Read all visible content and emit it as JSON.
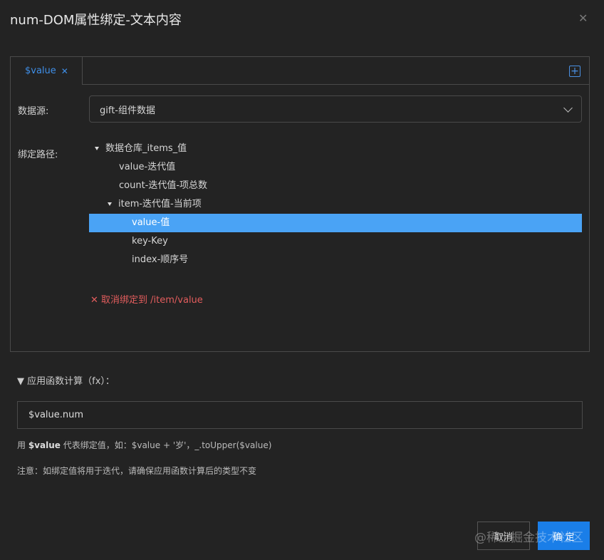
{
  "dialog": {
    "title": "num-DOM属性绑定-文本内容",
    "close_icon": "close-icon"
  },
  "tabs": [
    {
      "label": "$value",
      "close": "✕",
      "active": true
    }
  ],
  "add_tab": "+",
  "datasource": {
    "label": "数据源:",
    "value": "gift-组件数据"
  },
  "binding": {
    "label": "绑定路径:",
    "tree": [
      {
        "label": "数据仓库_items_值",
        "level": 0,
        "expanded": true
      },
      {
        "label": "value-迭代值",
        "level": 1
      },
      {
        "label": "count-迭代值-项总数",
        "level": 1
      },
      {
        "label": "item-迭代值-当前项",
        "level": 1,
        "expanded": true
      },
      {
        "label": "value-值",
        "level": 2,
        "selected": true
      },
      {
        "label": "key-Key",
        "level": 2
      },
      {
        "label": "index-顺序号",
        "level": 2
      }
    ],
    "unbind": "✕ 取消绑定到 /item/value"
  },
  "fx": {
    "header": "▼ 应用函数计算（fx）：",
    "value": "$value.num",
    "hint_prefix": "用 ",
    "hint_bold": "$value",
    "hint_suffix": " 代表绑定值，如：$value + '岁'，_.toUpper($value)",
    "note": "注意：如绑定值将用于迭代，请确保应用函数计算后的类型不变"
  },
  "footer": {
    "cancel": "取消",
    "ok": "确 定"
  },
  "watermark": "@稀土掘金技术社区",
  "colors": {
    "accent": "#1a7ee8",
    "selected_row": "#4aa3f5",
    "danger": "#e35d5d",
    "background": "#232323"
  }
}
